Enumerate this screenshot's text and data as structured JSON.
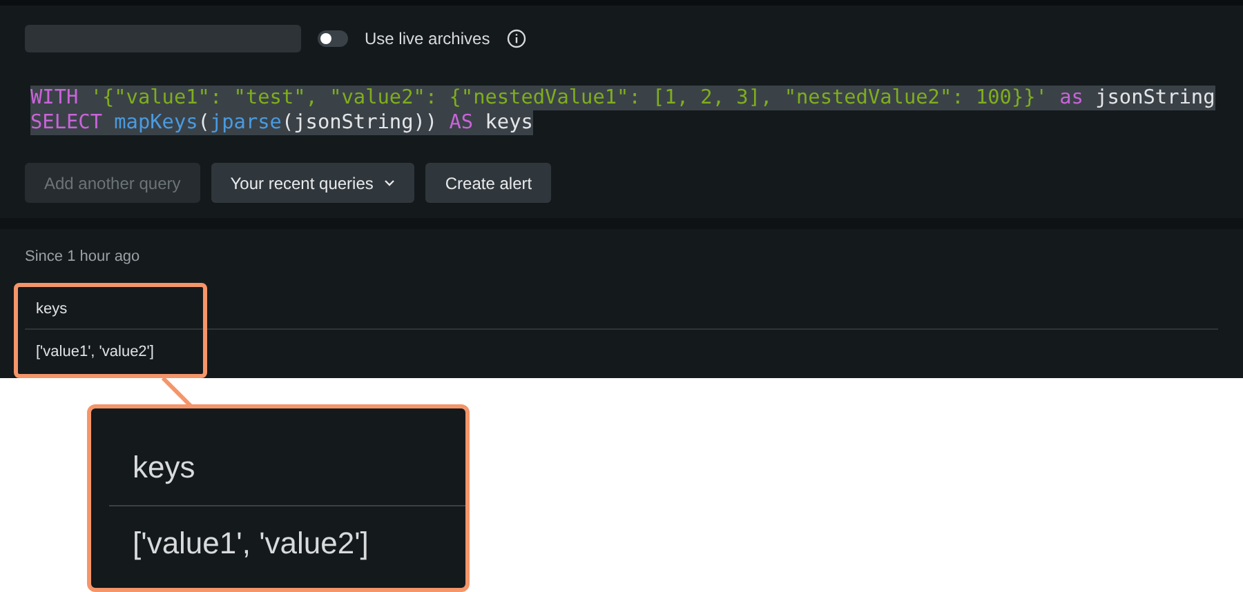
{
  "toolbar": {
    "toggle": {
      "label": "Use live archives",
      "on": false
    }
  },
  "query": {
    "lines": [
      [
        {
          "text": "WITH",
          "kind": "keyword"
        },
        {
          "text": " '{\"value1\": \"test\", \"value2\": {\"nestedValue1\": [1, 2, 3], \"nestedValue2\": 100}}'",
          "kind": "string"
        },
        {
          "text": " as",
          "kind": "keyword"
        },
        {
          "text": " jsonString",
          "kind": "plain"
        }
      ],
      [
        {
          "text": "SELECT",
          "kind": "keyword"
        },
        {
          "text": " mapKeys",
          "kind": "function"
        },
        {
          "text": "(",
          "kind": "plain"
        },
        {
          "text": "jparse",
          "kind": "function"
        },
        {
          "text": "(jsonString)) ",
          "kind": "plain"
        },
        {
          "text": "AS",
          "kind": "keyword"
        },
        {
          "text": " keys",
          "kind": "plain"
        }
      ]
    ]
  },
  "buttons": [
    {
      "label": "Add another query",
      "kind": "plain",
      "disabled": true
    },
    {
      "label": "Your recent queries",
      "kind": "dropdown",
      "disabled": false
    },
    {
      "label": "Create alert",
      "kind": "plain",
      "disabled": false
    }
  ],
  "results": {
    "time_range": "Since 1 hour ago",
    "table": {
      "columns": [
        "keys"
      ],
      "rows": [
        [
          "['value1', 'value2']"
        ]
      ]
    }
  },
  "callout": {
    "column": "keys",
    "value": "['value1', 'value2']"
  }
}
